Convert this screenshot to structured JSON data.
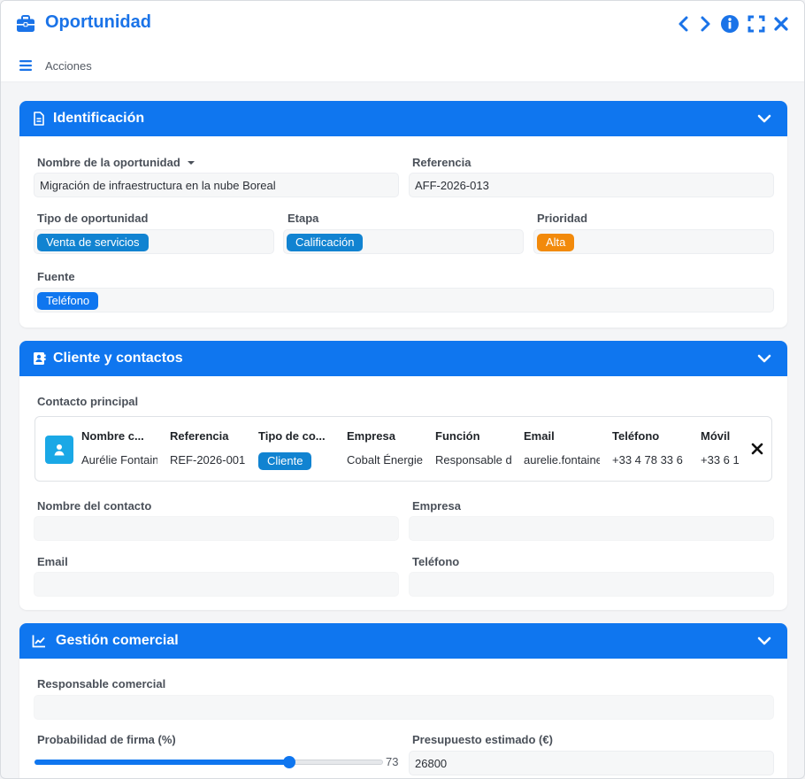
{
  "window": {
    "title": "Oportunidad",
    "icon": "briefcase-icon",
    "accent": "#1a73e8"
  },
  "actions": {
    "label": "Acciones"
  },
  "sections": {
    "identificacion": {
      "title": "Identificación",
      "fields": {
        "nombre_label": "Nombre de la oportunidad",
        "nombre_value": "Migración de infraestructura en la nube Boreal",
        "referencia_label": "Referencia",
        "referencia_value": "AFF-2026-013",
        "tipo_label": "Tipo de oportunidad",
        "tipo_value": "Venta de servicios",
        "etapa_label": "Etapa",
        "etapa_value": "Calificación",
        "prioridad_label": "Prioridad",
        "prioridad_value": "Alta",
        "fuente_label": "Fuente",
        "fuente_value": "Teléfono"
      },
      "colors": {
        "tipo": "#1183d1",
        "etapa": "#1183d1",
        "prioridad": "#f28a0b",
        "fuente": "#0f76ef"
      }
    },
    "cliente": {
      "title": "Cliente y contactos",
      "contacto_principal_label": "Contacto principal",
      "contact": {
        "columns": [
          {
            "header": "Nombre c...",
            "value": "Aurélie Fontaine"
          },
          {
            "header": "Referencia",
            "value": "REF-2026-001"
          },
          {
            "header": "Tipo de co...",
            "value": "Cliente",
            "badge": true
          },
          {
            "header": "Empresa",
            "value": "Cobalt Énergie"
          },
          {
            "header": "Función",
            "value": "Responsable de"
          },
          {
            "header": "Email",
            "value": "aurelie.fontaine"
          },
          {
            "header": "Teléfono",
            "value": "+33 4 78 33 6"
          },
          {
            "header": "Móvil",
            "value": "+33 6 1"
          }
        ]
      },
      "fields": {
        "nombre_contacto_label": "Nombre del contacto",
        "nombre_contacto_value": "",
        "empresa_label": "Empresa",
        "empresa_value": "",
        "email_label": "Email",
        "email_value": "",
        "telefono_label": "Teléfono",
        "telefono_value": ""
      }
    },
    "gestion": {
      "title": "Gestión comercial",
      "fields": {
        "responsable_label": "Responsable comercial",
        "responsable_value": "",
        "probabilidad_label": "Probabilidad de firma (%)",
        "probabilidad_value": 73,
        "presupuesto_label": "Presupuesto estimado (€)",
        "presupuesto_value": "26800"
      }
    }
  }
}
